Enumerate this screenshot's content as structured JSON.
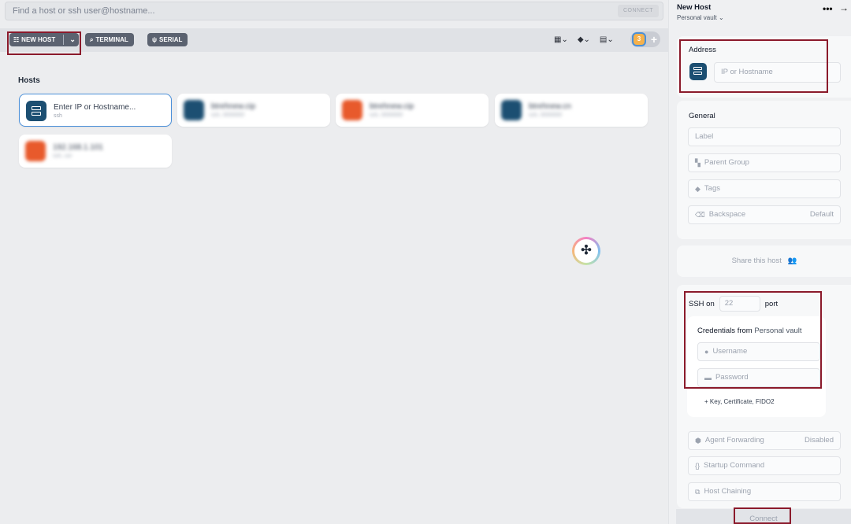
{
  "search": {
    "placeholder": "Find a host or ssh user@hostname...",
    "connect_label": "CONNECT"
  },
  "toolbar": {
    "new_host_label": "NEW HOST",
    "terminal_label": "TERMINAL",
    "serial_label": "SERIAL",
    "avatar_count": "3"
  },
  "hosts": {
    "title": "Hosts",
    "new_card": {
      "title": "Enter IP or Hostname...",
      "subtitle": "ssh"
    },
    "items": [
      {
        "title": "btrehnew.cip",
        "subtitle": "ssh, 0000000",
        "icon": "server-icon",
        "color": "#1c4f72"
      },
      {
        "title": "btrehnew.cip",
        "subtitle": "ssh, 0000000",
        "icon": "ubuntu-icon",
        "color": "#e85a2c"
      },
      {
        "title": "btrehnew.cn",
        "subtitle": "ssh, 0000000",
        "icon": "server-icon",
        "color": "#1c4f72"
      },
      {
        "title": "192.168.1.101",
        "subtitle": "ssh, usr",
        "icon": "ubuntu-icon",
        "color": "#e85a2c"
      }
    ]
  },
  "panel": {
    "title": "New Host",
    "subtitle": "Personal vault",
    "address": {
      "label": "Address",
      "placeholder": "IP or Hostname"
    },
    "general": {
      "label": "General",
      "label_placeholder": "Label",
      "parent_group": "Parent Group",
      "tags": "Tags",
      "backspace": "Backspace",
      "backspace_value": "Default"
    },
    "share_label": "Share this host",
    "ssh": {
      "prefix": "SSH on",
      "port": "22",
      "suffix": "port",
      "credentials_label": "Credentials from",
      "credentials_source": "Personal vault",
      "username_placeholder": "Username",
      "password_placeholder": "Password",
      "add_key": "+ Key, Certificate, FIDO2"
    },
    "agent_forwarding": "Agent Forwarding",
    "agent_forwarding_value": "Disabled",
    "startup_command": "Startup Command",
    "host_chaining": "Host Chaining",
    "connect_label": "Connect"
  },
  "colors": {
    "accent_red": "#8b1a2b",
    "server_blue": "#1c4f72",
    "ubuntu_orange": "#e85a2c",
    "focus_blue": "#4a8fd9"
  }
}
